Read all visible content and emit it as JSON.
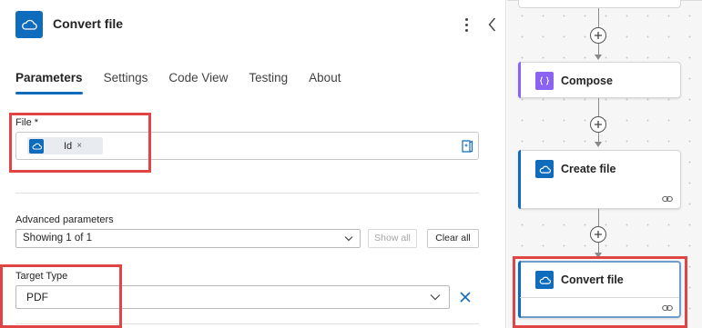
{
  "panel": {
    "title": "Convert file",
    "app_icon": "cloud-icon",
    "more_icon": "more-vertical-icon",
    "collapse_icon": "chevron-left-icon",
    "tabs": [
      {
        "label": "Parameters",
        "active": true
      },
      {
        "label": "Settings",
        "active": false
      },
      {
        "label": "Code View",
        "active": false
      },
      {
        "label": "Testing",
        "active": false
      },
      {
        "label": "About",
        "active": false
      }
    ],
    "file_field": {
      "label": "File *",
      "token_label": "Id",
      "token_remove": "×",
      "token_icon": "cloud-icon",
      "dynamic_content_icon": "dynamic-content-icon"
    },
    "advanced": {
      "label": "Advanced parameters",
      "selected": "Showing 1 of 1",
      "show_all": "Show all",
      "clear_all": "Clear all"
    },
    "target_type": {
      "label": "Target Type",
      "value": "PDF",
      "remove_icon": "close-icon"
    }
  },
  "canvas": {
    "cards": [
      {
        "title": "Compose",
        "icon": "compose-icon",
        "color": "#8a63f2"
      },
      {
        "title": "Create file",
        "icon": "cloud-icon",
        "color": "#0f6cbd"
      },
      {
        "title": "Convert file",
        "icon": "cloud-icon",
        "color": "#0f6cbd",
        "selected": true
      }
    ],
    "add_icon": "plus-icon",
    "link_icon": "link-icon"
  },
  "colors": {
    "accent": "#0f6cbd",
    "highlight": "#e04444",
    "compose": "#8a63f2"
  }
}
